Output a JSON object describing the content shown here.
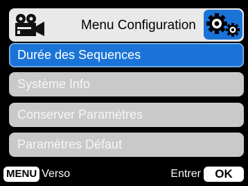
{
  "header": {
    "title": "Menu Configuration",
    "left_icon": "video-camera-icon",
    "right_icon": "gears-icon",
    "accent_color": "#1a74d8"
  },
  "menu": {
    "items": [
      {
        "label": "Durée des Sequences",
        "selected": true
      },
      {
        "label": "Système Info",
        "selected": false
      },
      {
        "label": "Conserver Paramètres",
        "selected": false
      },
      {
        "label": "Paramètres Défaut",
        "selected": false
      }
    ]
  },
  "footer": {
    "menu_key": "MENU",
    "back_label": "Verso",
    "enter_label": "Entrer",
    "ok_key": "OK"
  }
}
